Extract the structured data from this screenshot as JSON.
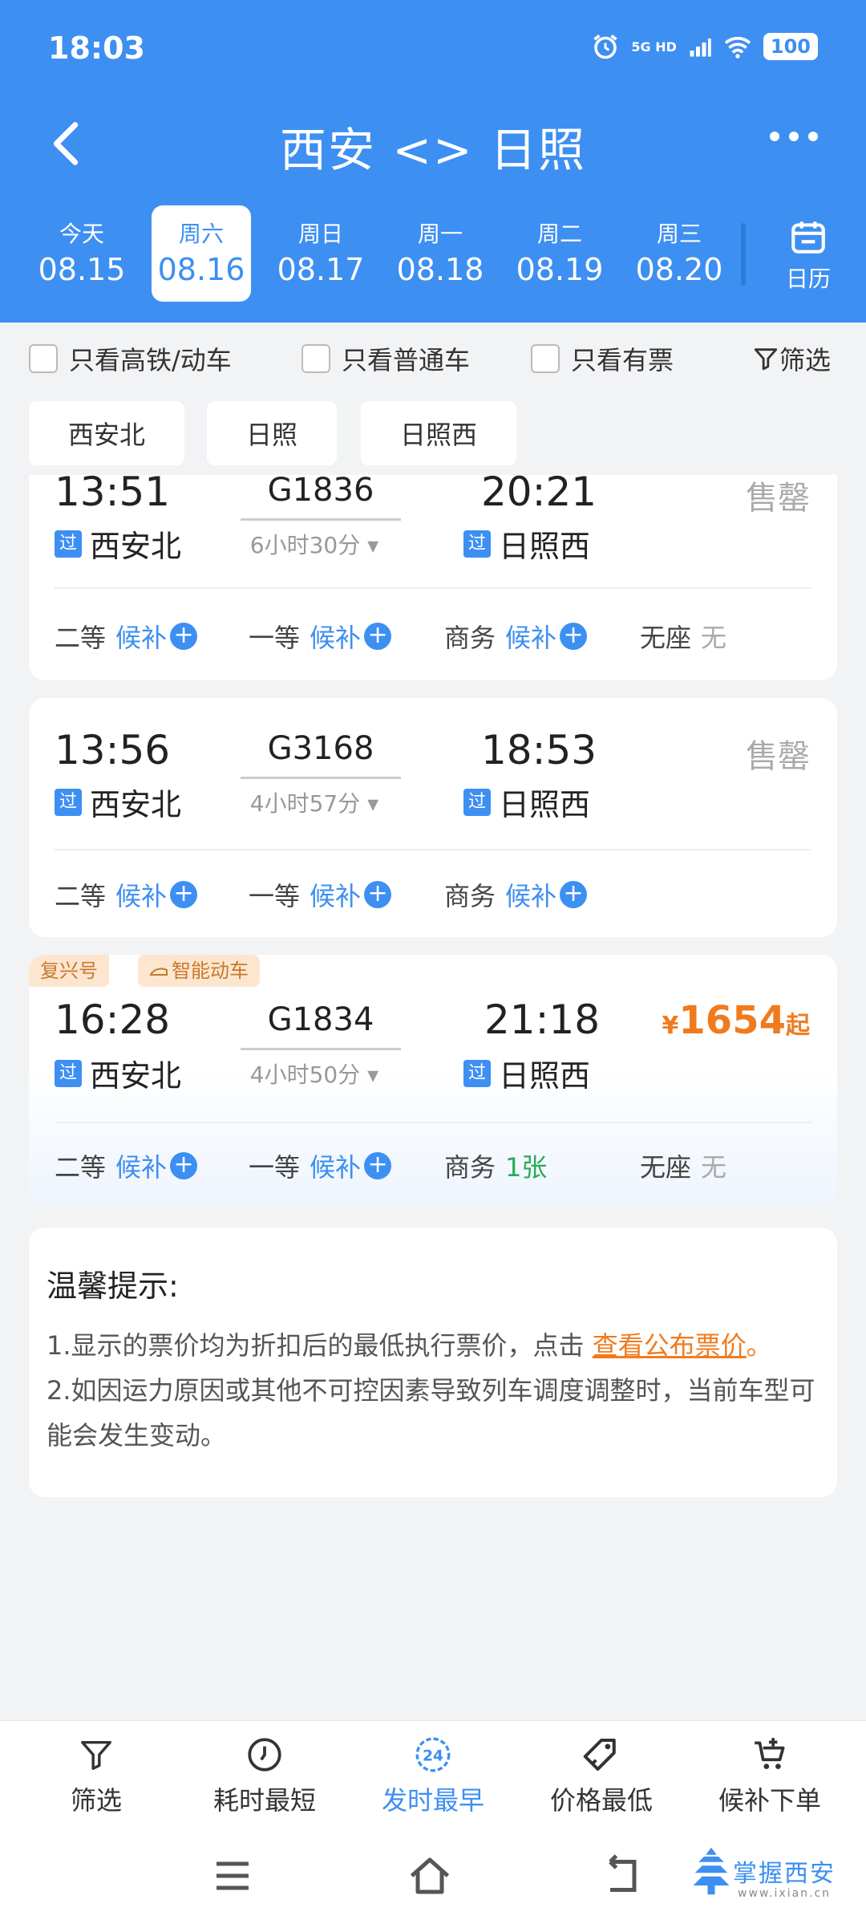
{
  "status_bar": {
    "time": "18:03",
    "network": "5G HD",
    "battery": "100"
  },
  "header": {
    "title": "西安 <> 日照"
  },
  "dates": [
    {
      "day": "今天",
      "date": "08.15",
      "active": false
    },
    {
      "day": "周六",
      "date": "08.16",
      "active": true
    },
    {
      "day": "周日",
      "date": "08.17",
      "active": false
    },
    {
      "day": "周一",
      "date": "08.18",
      "active": false
    },
    {
      "day": "周二",
      "date": "08.19",
      "active": false
    },
    {
      "day": "周三",
      "date": "08.20",
      "active": false
    }
  ],
  "calendar_label": "日历",
  "filters": {
    "gaotie": "只看高铁/动车",
    "putong": "只看普通车",
    "youpiao": "只看有票",
    "shaixuan": "筛选"
  },
  "stations": [
    "西安北",
    "日照",
    "日照西"
  ],
  "trains": [
    {
      "dep_time": "13:51",
      "train_no": "G1836",
      "arr_time": "20:21",
      "duration": "6小时30分",
      "status": "售罄",
      "from": "西安北",
      "to": "日照西",
      "pass_mark": "过",
      "seats": [
        {
          "name": "二等",
          "value": "候补"
        },
        {
          "name": "一等",
          "value": "候补"
        },
        {
          "name": "商务",
          "value": "候补"
        },
        {
          "name": "无座",
          "value": "无"
        }
      ]
    },
    {
      "dep_time": "13:56",
      "train_no": "G3168",
      "arr_time": "18:53",
      "duration": "4小时57分",
      "status": "售罄",
      "from": "西安北",
      "to": "日照西",
      "pass_mark": "过",
      "seats": [
        {
          "name": "二等",
          "value": "候补"
        },
        {
          "name": "一等",
          "value": "候补"
        },
        {
          "name": "商务",
          "value": "候补"
        }
      ]
    },
    {
      "dep_time": "16:28",
      "train_no": "G1834",
      "arr_time": "21:18",
      "duration": "4小时50分",
      "tags": [
        "复兴号",
        "智能动车"
      ],
      "price_symbol": "¥",
      "price": "1654",
      "price_suffix": "起",
      "from": "西安北",
      "to": "日照西",
      "pass_mark": "过",
      "seats": [
        {
          "name": "二等",
          "value": "候补"
        },
        {
          "name": "一等",
          "value": "候补"
        },
        {
          "name": "商务",
          "value": "1张"
        },
        {
          "name": "无座",
          "value": "无"
        }
      ]
    }
  ],
  "tips": {
    "title": "温馨提示:",
    "line1_text": "1.显示的票价均为折扣后的最低执行票价，点击",
    "line1_link": "查看公布票价",
    "line1_end": "。",
    "line2": "2.如因运力原因或其他不可控因素导致列车调度调整时，当前车型可能会发生变动。"
  },
  "tabbar": [
    {
      "label": "筛选",
      "icon": "filter-icon"
    },
    {
      "label": "耗时最短",
      "icon": "timer-icon"
    },
    {
      "label": "发时最早",
      "icon": "clock-24-icon",
      "badge": "24"
    },
    {
      "label": "价格最低",
      "icon": "price-tag-icon"
    },
    {
      "label": "候补下单",
      "icon": "cart-plus-icon"
    }
  ],
  "watermark": {
    "text": "掌握西安",
    "sub": "www.ixian.cn"
  },
  "colors": {
    "primary": "#3d8ff2",
    "price": "#f07b1e",
    "available": "#2aaa5a"
  }
}
